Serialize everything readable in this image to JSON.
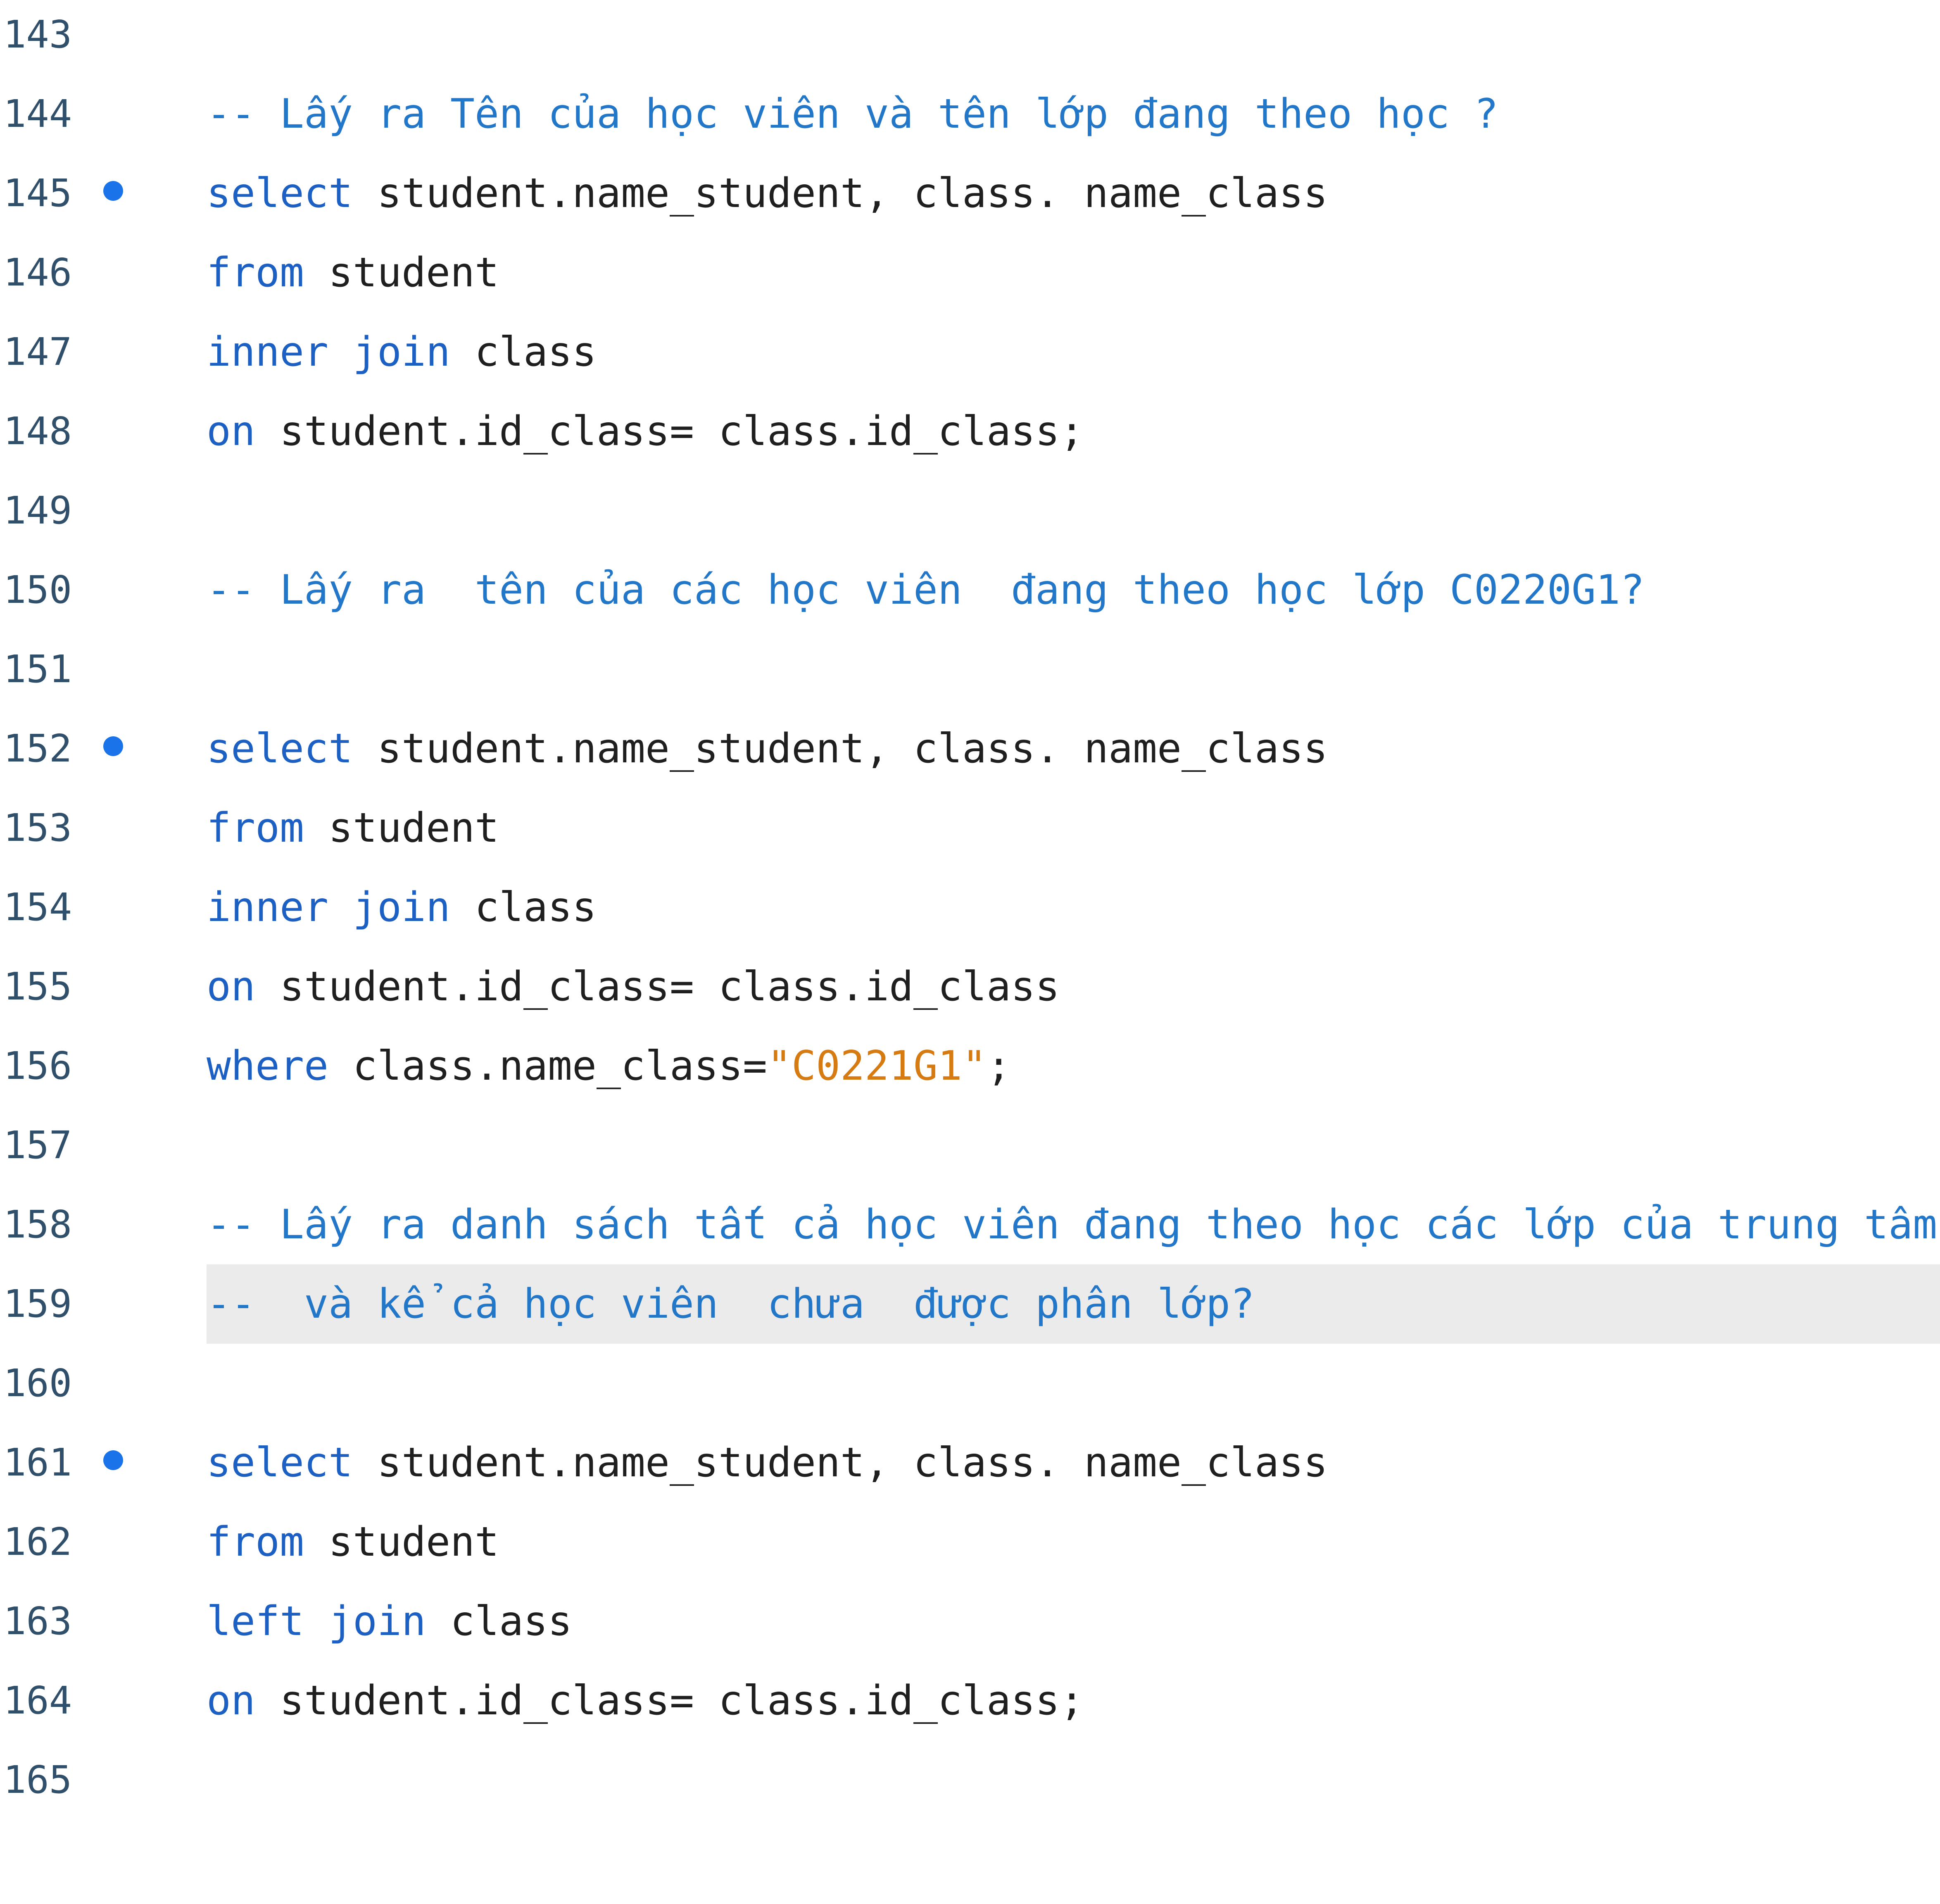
{
  "editor": {
    "lines": [
      {
        "number": "143",
        "breakpoint": false,
        "highlighted": false,
        "tokens": []
      },
      {
        "number": "144",
        "breakpoint": false,
        "highlighted": false,
        "tokens": [
          {
            "type": "comment",
            "text": "-- Lấy ra Tên của học viên và tên lớp đang theo học ?"
          }
        ]
      },
      {
        "number": "145",
        "breakpoint": true,
        "highlighted": false,
        "tokens": [
          {
            "type": "kw",
            "text": "select"
          },
          {
            "type": "id",
            "text": " student.name_student, class. name_class"
          }
        ]
      },
      {
        "number": "146",
        "breakpoint": false,
        "highlighted": false,
        "tokens": [
          {
            "type": "kw",
            "text": "from"
          },
          {
            "type": "id",
            "text": " student"
          }
        ]
      },
      {
        "number": "147",
        "breakpoint": false,
        "highlighted": false,
        "tokens": [
          {
            "type": "kw",
            "text": "inner join"
          },
          {
            "type": "id",
            "text": " class"
          }
        ]
      },
      {
        "number": "148",
        "breakpoint": false,
        "highlighted": false,
        "tokens": [
          {
            "type": "kw",
            "text": "on"
          },
          {
            "type": "id",
            "text": " student.id_class= class.id_class;"
          }
        ]
      },
      {
        "number": "149",
        "breakpoint": false,
        "highlighted": false,
        "tokens": []
      },
      {
        "number": "150",
        "breakpoint": false,
        "highlighted": false,
        "tokens": [
          {
            "type": "comment",
            "text": "-- Lấy ra  tên của các học viên  đang theo học lớp C0220G1?"
          }
        ]
      },
      {
        "number": "151",
        "breakpoint": false,
        "highlighted": false,
        "tokens": []
      },
      {
        "number": "152",
        "breakpoint": true,
        "highlighted": false,
        "tokens": [
          {
            "type": "kw",
            "text": "select"
          },
          {
            "type": "id",
            "text": " student.name_student, class. name_class"
          }
        ]
      },
      {
        "number": "153",
        "breakpoint": false,
        "highlighted": false,
        "tokens": [
          {
            "type": "kw",
            "text": "from"
          },
          {
            "type": "id",
            "text": " student"
          }
        ]
      },
      {
        "number": "154",
        "breakpoint": false,
        "highlighted": false,
        "tokens": [
          {
            "type": "kw",
            "text": "inner join"
          },
          {
            "type": "id",
            "text": " class"
          }
        ]
      },
      {
        "number": "155",
        "breakpoint": false,
        "highlighted": false,
        "tokens": [
          {
            "type": "kw",
            "text": "on"
          },
          {
            "type": "id",
            "text": " student.id_class= class.id_class"
          }
        ]
      },
      {
        "number": "156",
        "breakpoint": false,
        "highlighted": false,
        "tokens": [
          {
            "type": "kw",
            "text": "where"
          },
          {
            "type": "id",
            "text": " class.name_class="
          },
          {
            "type": "str",
            "text": "\"C0221G1\""
          },
          {
            "type": "id",
            "text": ";"
          }
        ]
      },
      {
        "number": "157",
        "breakpoint": false,
        "highlighted": false,
        "tokens": []
      },
      {
        "number": "158",
        "breakpoint": false,
        "highlighted": false,
        "tokens": [
          {
            "type": "comment",
            "text": "-- Lấy ra danh sách tất cả học viên đang theo học các lớp của trung tâm"
          }
        ]
      },
      {
        "number": "159",
        "breakpoint": false,
        "highlighted": true,
        "tokens": [
          {
            "type": "comment",
            "text": "--  và kể cả học viên  chưa  được phân lớp?"
          }
        ]
      },
      {
        "number": "160",
        "breakpoint": false,
        "highlighted": false,
        "tokens": []
      },
      {
        "number": "161",
        "breakpoint": true,
        "highlighted": false,
        "tokens": [
          {
            "type": "kw",
            "text": "select"
          },
          {
            "type": "id",
            "text": " student.name_student, class. name_class"
          }
        ]
      },
      {
        "number": "162",
        "breakpoint": false,
        "highlighted": false,
        "tokens": [
          {
            "type": "kw",
            "text": "from"
          },
          {
            "type": "id",
            "text": " student"
          }
        ]
      },
      {
        "number": "163",
        "breakpoint": false,
        "highlighted": false,
        "tokens": [
          {
            "type": "kw",
            "text": "left join"
          },
          {
            "type": "id",
            "text": " class"
          }
        ]
      },
      {
        "number": "164",
        "breakpoint": false,
        "highlighted": false,
        "tokens": [
          {
            "type": "kw",
            "text": "on"
          },
          {
            "type": "id",
            "text": " student.id_class= class.id_class;"
          }
        ]
      },
      {
        "number": "165",
        "breakpoint": false,
        "highlighted": false,
        "tokens": []
      }
    ]
  }
}
